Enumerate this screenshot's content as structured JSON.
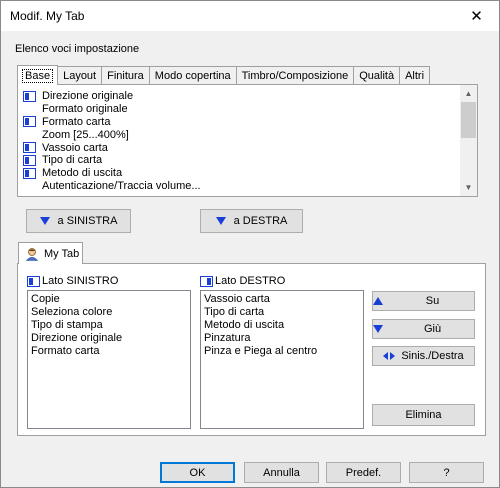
{
  "window": {
    "title": "Modif. My Tab",
    "close_symbol": "✕"
  },
  "settings": {
    "label": "Elenco voci impostazione",
    "tabs": [
      "Base",
      "Layout",
      "Finitura",
      "Modo copertina",
      "Timbro/Composizione",
      "Qualità",
      "Altri"
    ],
    "active_tab": "Base",
    "items": [
      {
        "label": "Direzione originale",
        "icon": "settings-item-icon"
      },
      {
        "label": "Formato originale",
        "icon": ""
      },
      {
        "label": "Formato carta",
        "icon": "settings-item-icon"
      },
      {
        "label": "Zoom [25...400%]",
        "icon": ""
      },
      {
        "label": "Vassoio carta",
        "icon": "settings-item-icon"
      },
      {
        "label": "Tipo di carta",
        "icon": "settings-item-icon"
      },
      {
        "label": "Metodo di uscita",
        "icon": "settings-item-icon"
      },
      {
        "label": "Autenticazione/Traccia volume...",
        "icon": ""
      }
    ]
  },
  "move_buttons": {
    "left": "a SINISTRA",
    "right": "a DESTRA"
  },
  "mytab": {
    "tab_label": "My Tab",
    "left_label": "Lato SINISTRO",
    "right_label": "Lato DESTRO",
    "left_items": [
      "Copie",
      "Seleziona colore",
      "Tipo di stampa",
      "Direzione originale",
      "Formato carta"
    ],
    "right_items": [
      "Vassoio carta",
      "Tipo di carta",
      "Metodo di uscita",
      "Pinzatura",
      "Pinza e Piega al centro"
    ],
    "buttons": {
      "up": "Su",
      "down": "Giù",
      "swap": "Sinis./Destra",
      "delete": "Elimina"
    }
  },
  "footer": {
    "ok": "OK",
    "cancel": "Annulla",
    "default": "Predef.",
    "help": "?"
  },
  "colors": {
    "arrow": "#1a3fd6",
    "accent": "#0078d7"
  }
}
